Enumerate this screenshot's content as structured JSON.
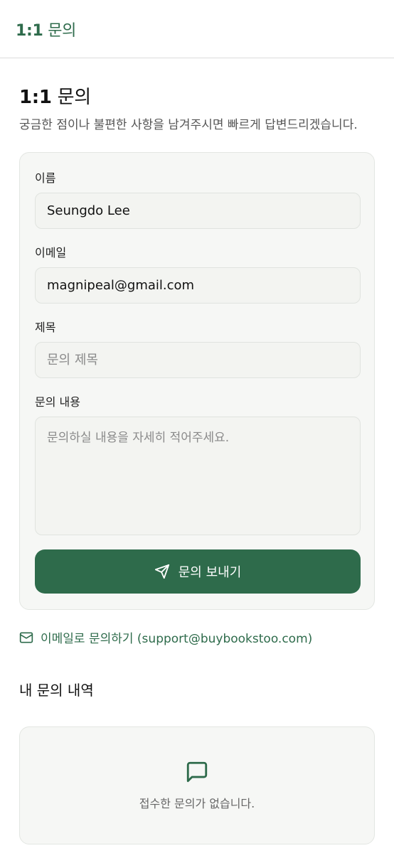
{
  "header": {
    "title_num": "1:1",
    "title_text": "문의"
  },
  "page": {
    "title_num": "1:1",
    "title_text": "문의",
    "subtitle": "궁금한 점이나 불편한 사항을 남겨주시면 빠르게 답변드리겠습니다."
  },
  "form": {
    "name": {
      "label": "이름",
      "value": "Seungdo Lee",
      "placeholder": ""
    },
    "email": {
      "label": "이메일",
      "value": "magnipeal@gmail.com",
      "placeholder": ""
    },
    "subject": {
      "label": "제목",
      "value": "",
      "placeholder": "문의 제목"
    },
    "message": {
      "label": "문의 내용",
      "value": "",
      "placeholder": "문의하실 내용을 자세히 적어주세요."
    },
    "submit_label": "문의 보내기"
  },
  "email_contact": {
    "label": "이메일로 문의하기 (support@buybookstoo.com)"
  },
  "history": {
    "title": "내 문의 내역",
    "empty_text": "접수한 문의가 없습니다."
  },
  "colors": {
    "accent": "#2e6b4b",
    "card_bg": "#f6f7f5",
    "border": "#e3e6e2"
  },
  "icons": {
    "submit": "send-icon",
    "email": "mail-icon",
    "empty": "message-square-icon"
  }
}
